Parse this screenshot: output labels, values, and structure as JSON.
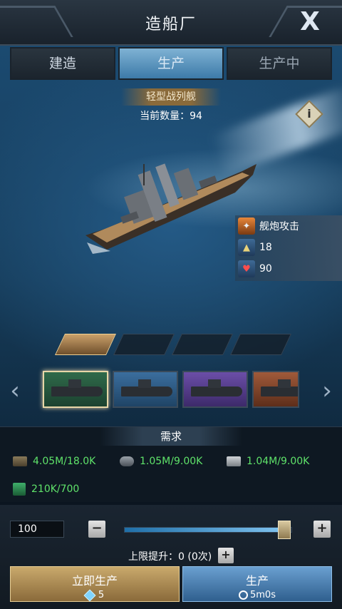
{
  "header": {
    "title": "造船厂",
    "close_label": "X"
  },
  "tabs": [
    {
      "label": "建造"
    },
    {
      "label": "生产"
    },
    {
      "label": "生产中"
    }
  ],
  "ship": {
    "name": "轻型战列舰",
    "count_label": "当前数量：94"
  },
  "info_label": "i",
  "stats": {
    "attack_label": "舰炮攻击",
    "ammo_value": "18",
    "hp_value": "90"
  },
  "requirements": {
    "title": "需求",
    "items": [
      {
        "icon": "steel-icon",
        "value": "4.05M/18.0K"
      },
      {
        "icon": "pipe-icon",
        "value": "1.05M/9.00K"
      },
      {
        "icon": "ingot-icon",
        "value": "1.04M/9.00K"
      },
      {
        "icon": "book-icon",
        "value": "210K/700"
      }
    ]
  },
  "controls": {
    "quantity": "100",
    "minus_label": "−",
    "plus_label": "+",
    "slider_level": 0.95,
    "limit_label": "上限提升：0 (0次)",
    "limit_plus_label": "+"
  },
  "actions": {
    "instant_label": "立即生产",
    "instant_cost": "5",
    "produce_label": "生产",
    "produce_time": "5m0s"
  },
  "colors": {
    "accent_green": "#5fe36a",
    "gold": "#c9a96c",
    "blue": "#6a9fd0"
  }
}
